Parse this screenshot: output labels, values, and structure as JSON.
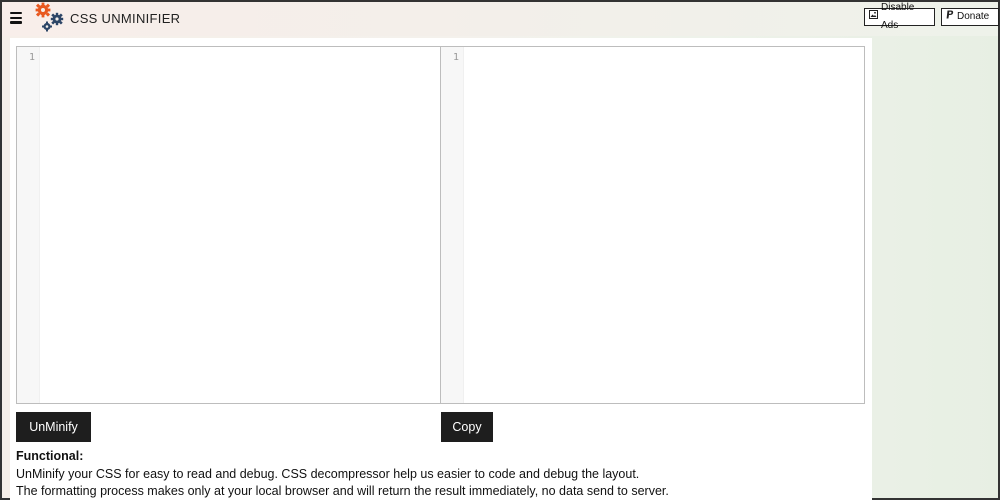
{
  "header": {
    "title": "CSS UNMINIFIER",
    "disable_ads_label": "Disable Ads",
    "donate_label": "Donate",
    "menu_icon": "hamburger-icon",
    "logo_icon": "gears-logo-icon"
  },
  "editors": {
    "input_line_number": "1",
    "output_line_number": "1"
  },
  "actions": {
    "unminify_label": "UnMinify",
    "copy_label": "Copy"
  },
  "info": {
    "heading": "Functional:",
    "line1": "UnMinify your CSS for easy to read and debug. CSS decompressor help us easier to code and debug the layout.",
    "line2": "The formatting process makes only at your local browser and will return the result immediately, no data send to server."
  },
  "colors": {
    "gear_orange": "#e8581f",
    "gear_navy": "#2c4566",
    "button_dark": "#1e1e1e"
  }
}
